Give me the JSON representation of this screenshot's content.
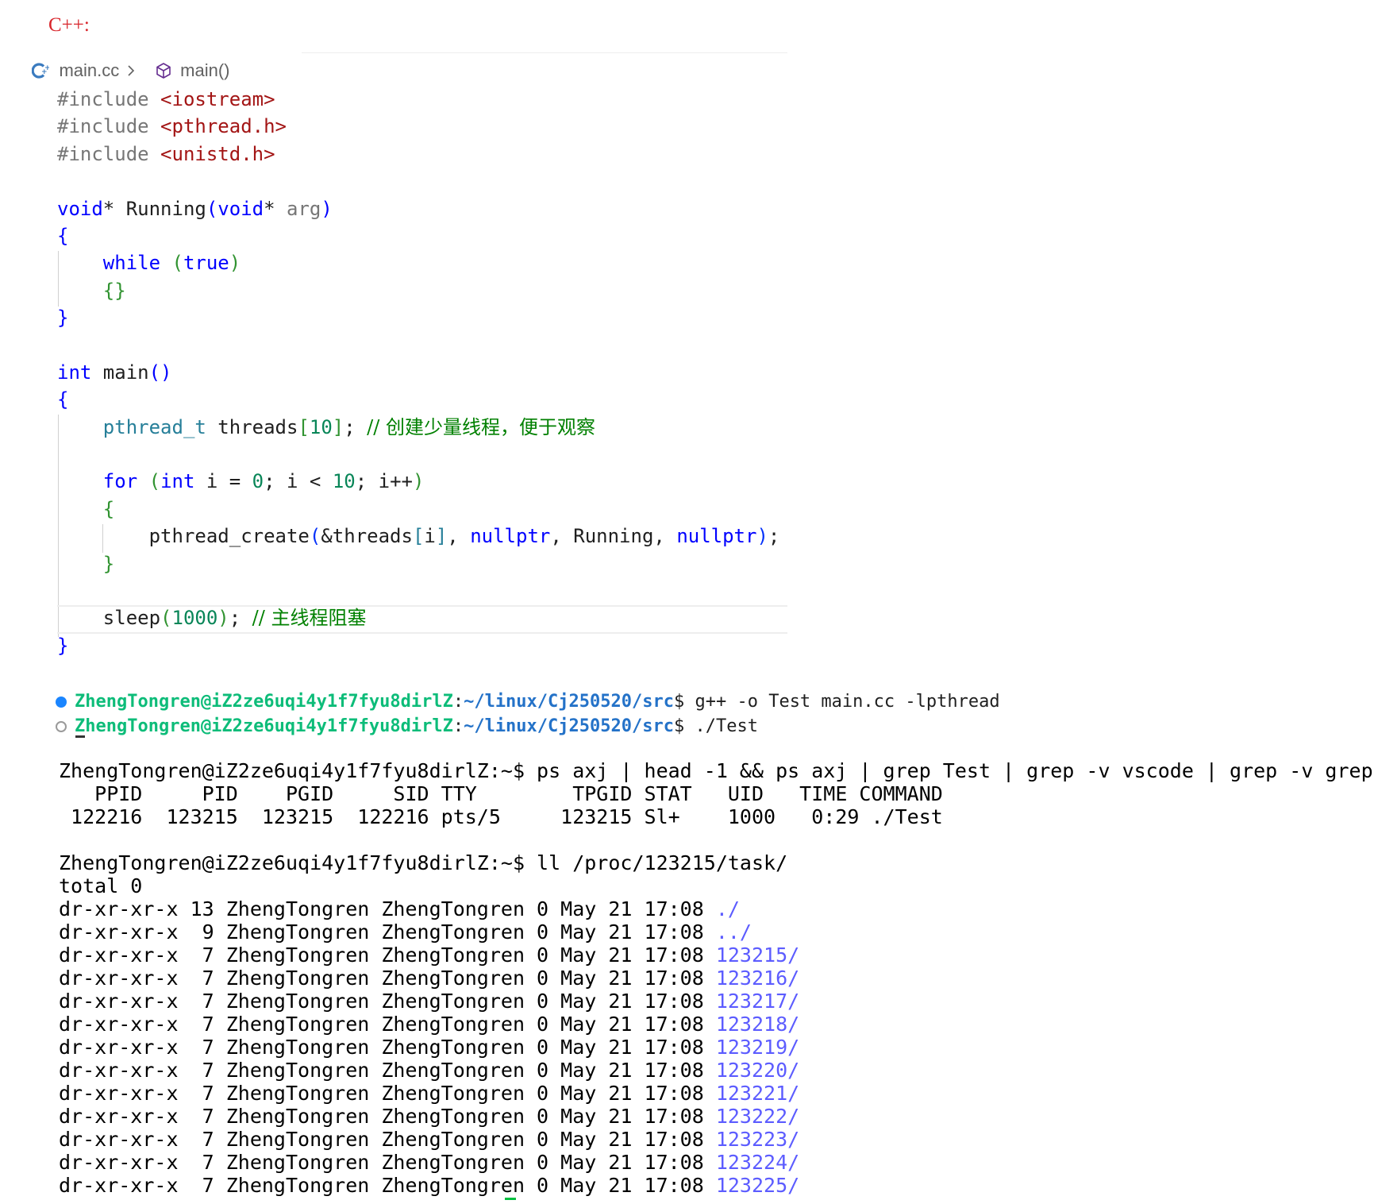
{
  "heading": "C++:",
  "editor": {
    "breadcrumb_file": "main.cc",
    "breadcrumb_symbol": "main()",
    "code_lines": [
      "#include <iostream>",
      "#include <pthread.h>",
      "#include <unistd.h>",
      "",
      "void* Running(void* arg)",
      "{",
      "    while (true)",
      "    {}",
      "}",
      "",
      "int main()",
      "{",
      "    pthread_t threads[10]; // 创建少量线程，便于观察",
      "",
      "    for (int i = 0; i < 10; i++)",
      "    {",
      "        pthread_create(&threads[i], nullptr, Running, nullptr);",
      "    }",
      "",
      "    sleep(1000); // 主线程阻塞",
      "}"
    ]
  },
  "vscode_terminal": [
    {
      "status": "success",
      "user_host": "ZhengTongren@iZ2ze6uqi4y1f7fyu8dirlZ",
      "path": "~/linux/Cj250520/src",
      "command": "g++ -o Test main.cc -lpthread"
    },
    {
      "status": "running",
      "user_host": "ZhengTongren@iZ2ze6uqi4y1f7fyu8dirlZ",
      "path": "~/linux/Cj250520/src",
      "command": "./Test"
    }
  ],
  "shell": {
    "ps_command": "ZhengTongren@iZ2ze6uqi4y1f7fyu8dirlZ:~$ ps axj | head -1 && ps axj | grep Test | grep -v vscode | grep -v grep",
    "ps_header": "   PPID     PID    PGID     SID TTY        TPGID STAT   UID   TIME COMMAND",
    "ps_row": " 122216  123215  123215  122216 pts/5     123215 Sl+    1000   0:29 ./Test",
    "ll_command": "ZhengTongren@iZ2ze6uqi4y1f7fyu8dirlZ:~$ ll /proc/123215/task/",
    "total": "total 0",
    "entries": [
      {
        "prefix": "dr-xr-xr-x 13 ZhengTongren ZhengTongren 0 May 21 17:08 ",
        "name": "./",
        "color": "#5c5cff"
      },
      {
        "prefix": "dr-xr-xr-x  9 ZhengTongren ZhengTongren 0 May 21 17:08 ",
        "name": "../",
        "color": "#5c5cff"
      },
      {
        "prefix": "dr-xr-xr-x  7 ZhengTongren ZhengTongren 0 May 21 17:08 ",
        "name": "123215/",
        "color": "#5c5cff"
      },
      {
        "prefix": "dr-xr-xr-x  7 ZhengTongren ZhengTongren 0 May 21 17:08 ",
        "name": "123216/",
        "color": "#5c5cff"
      },
      {
        "prefix": "dr-xr-xr-x  7 ZhengTongren ZhengTongren 0 May 21 17:08 ",
        "name": "123217/",
        "color": "#5c5cff"
      },
      {
        "prefix": "dr-xr-xr-x  7 ZhengTongren ZhengTongren 0 May 21 17:08 ",
        "name": "123218/",
        "color": "#5c5cff"
      },
      {
        "prefix": "dr-xr-xr-x  7 ZhengTongren ZhengTongren 0 May 21 17:08 ",
        "name": "123219/",
        "color": "#5c5cff"
      },
      {
        "prefix": "dr-xr-xr-x  7 ZhengTongren ZhengTongren 0 May 21 17:08 ",
        "name": "123220/",
        "color": "#5c5cff"
      },
      {
        "prefix": "dr-xr-xr-x  7 ZhengTongren ZhengTongren 0 May 21 17:08 ",
        "name": "123221/",
        "color": "#5c5cff"
      },
      {
        "prefix": "dr-xr-xr-x  7 ZhengTongren ZhengTongren 0 May 21 17:08 ",
        "name": "123222/",
        "color": "#5c5cff"
      },
      {
        "prefix": "dr-xr-xr-x  7 ZhengTongren ZhengTongren 0 May 21 17:08 ",
        "name": "123223/",
        "color": "#5c5cff"
      },
      {
        "prefix": "dr-xr-xr-x  7 ZhengTongren ZhengTongren 0 May 21 17:08 ",
        "name": "123224/",
        "color": "#5c5cff"
      },
      {
        "prefix": "dr-xr-xr-x  7 ZhengTongren ZhengTongren 0 May 21 17:08 ",
        "name": "123225/",
        "color": "#5c5cff"
      }
    ]
  }
}
